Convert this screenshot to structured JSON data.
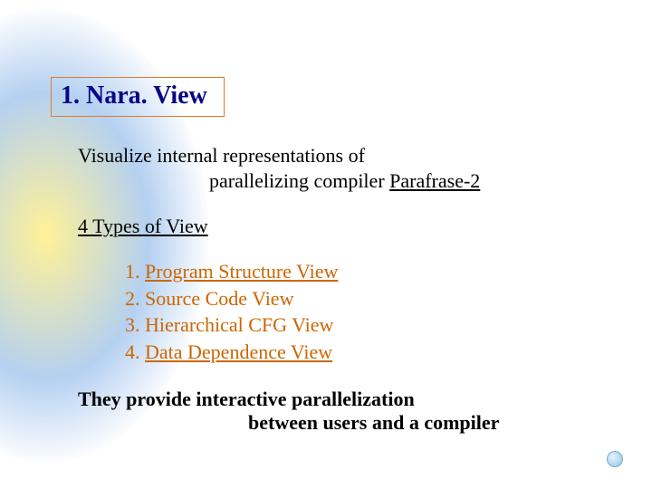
{
  "title": "1. Nara. View",
  "intro": {
    "line1": "Visualize internal representations of",
    "line2_prefix": "parallelizing compiler ",
    "line2_link": "Parafrase-2"
  },
  "types_heading": "4 Types of View",
  "views": [
    {
      "num": "1. ",
      "label": "Program Structure View",
      "underlined": true
    },
    {
      "num": "2. ",
      "label": "Source Code View",
      "underlined": false
    },
    {
      "num": "3. ",
      "label": "Hierarchical CFG View",
      "underlined": false
    },
    {
      "num": "4. ",
      "label": "Data Dependence View",
      "underlined": true
    }
  ],
  "closing": {
    "line1": "They provide interactive parallelization",
    "line2": "between users and a compiler"
  }
}
